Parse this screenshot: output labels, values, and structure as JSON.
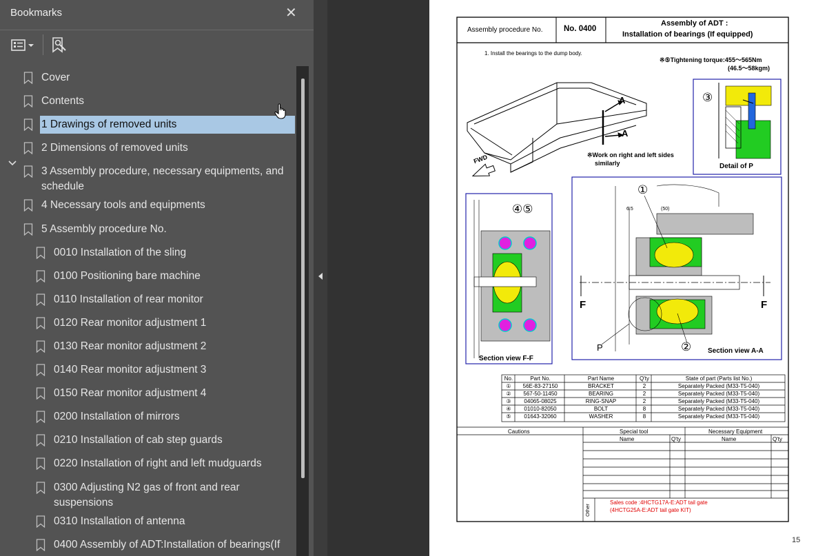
{
  "panel": {
    "title": "Bookmarks",
    "close_glyph": "✕",
    "items": [
      {
        "label": "Cover",
        "level": 0
      },
      {
        "label": "Contents",
        "level": 0
      },
      {
        "label": "1 Drawings of removed units",
        "level": 0,
        "selected": true
      },
      {
        "label": "2 Dimensions of removed units",
        "level": 0
      },
      {
        "label": "3 Assembly procedure, necessary equipments, and",
        "label2": "schedule",
        "level": 0
      },
      {
        "label": "4 Necessary tools and equipments",
        "level": 0
      },
      {
        "label": "5 Assembly procedure No.",
        "level": 0,
        "expanded": true
      },
      {
        "label": "0010 Installation of the sling",
        "level": 1
      },
      {
        "label": "0100 Positioning bare machine",
        "level": 1
      },
      {
        "label": "0110 Installation of rear monitor",
        "level": 1
      },
      {
        "label": "0120 Rear monitor adjustment 1",
        "level": 1
      },
      {
        "label": "0130 Rear monitor adjustment 2",
        "level": 1
      },
      {
        "label": "0140 Rear monitor adjustment 3",
        "level": 1
      },
      {
        "label": "0150 Rear monitor adjustment 4",
        "level": 1
      },
      {
        "label": "0200 Installation of mirrors",
        "level": 1
      },
      {
        "label": "0210 Installation of cab step guards",
        "level": 1
      },
      {
        "label": "0220 Installation of right and left mudguards",
        "level": 1
      },
      {
        "label": "0300 Adjusting N2 gas of front and rear",
        "label2": "suspensions",
        "level": 1
      },
      {
        "label": "0310 Installation of antenna",
        "level": 1
      },
      {
        "label": "0400 Assembly of ADT:Installation of bearings(If",
        "level": 1
      }
    ]
  },
  "document": {
    "header": {
      "proc_label": "Assembly procedure No.",
      "proc_no": "No. 0400",
      "title1": "Assembly of ADT :",
      "title2": "Installation of bearings (If equipped)"
    },
    "step": "1. Install the bearings to the dump body.",
    "torque1": "※⑤Tightening torque:455～565Nm",
    "torque2": "(46.5～58kgm)",
    "work_note1": "※Work on right and left sides",
    "work_note2": "similarly",
    "fwd": "FWD",
    "label_a": "A",
    "label_f": "F",
    "label_p": "P",
    "detail_p": "Detail of P",
    "section_ff": "Section view F-F",
    "section_aa": "Section view A-A",
    "num_1": "①",
    "num_2": "②",
    "num_3": "③",
    "num_45": "④⑤",
    "dim_65": "6.5",
    "dim_50": "(50)",
    "parts_headers": [
      "No.",
      "Part No.",
      "Part Name",
      "Q'ty",
      "State of part (Parts list No.)"
    ],
    "parts": [
      [
        "①",
        "56E-83-27150",
        "BRACKET",
        "2",
        "Separately Packed (M33-T5-040)"
      ],
      [
        "②",
        "567-50-11450",
        "BEARING",
        "2",
        "Separately Packed (M33-T5-040)"
      ],
      [
        "③",
        "04065-08025",
        "RING-SNAP",
        "2",
        "Separately Packed (M33-T5-040)"
      ],
      [
        "④",
        "01010-82050",
        "BOLT",
        "8",
        "Separately Packed (M33-T5-040)"
      ],
      [
        "⑤",
        "01643-32060",
        "WASHER",
        "8",
        "Separately Packed (M33-T5-040)"
      ]
    ],
    "bottom": {
      "cautions": "Cautions",
      "special_tool": "Special tool",
      "necessary_equipment": "Necessary Equipment",
      "name": "Name",
      "qty": "Q'ty",
      "other": "Other",
      "sales1": "Sales code :4HCTG17A-E:ADT tail gate",
      "sales2": "(4HCTG25A-E:ADT tail gate KIT)"
    },
    "page_number": "15"
  },
  "colors": {
    "panel_bg": "#535353",
    "selection": "#a9c8e4",
    "part_yellow": "#f2ea0a",
    "part_green": "#22cc22",
    "bolt_magenta": "#e020e0",
    "frame_blue": "#2222aa",
    "sales_red": "#e00000"
  }
}
